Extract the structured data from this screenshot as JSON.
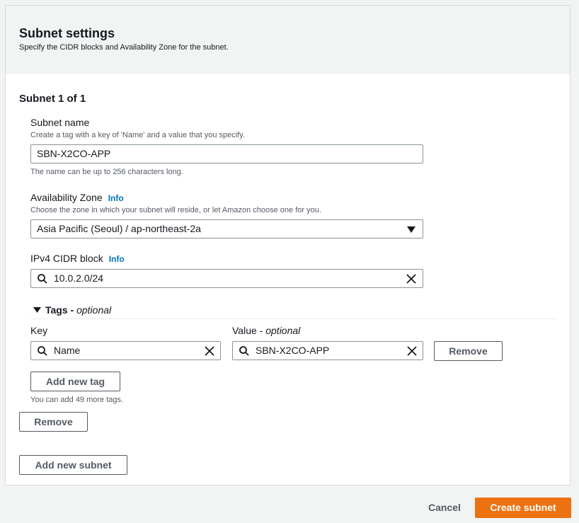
{
  "section": {
    "title": "Subnet settings",
    "description": "Specify the CIDR blocks and Availability Zone for the subnet."
  },
  "subnet": {
    "heading": "Subnet 1 of 1",
    "name": {
      "label": "Subnet name",
      "description": "Create a tag with a key of 'Name' and a value that you specify.",
      "value": "SBN-X2CO-APP",
      "hint": "The name can be up to 256 characters long."
    },
    "az": {
      "label": "Availability Zone",
      "info": "Info",
      "description": "Choose the zone in which your subnet will reside, or let Amazon choose one for you.",
      "value": "Asia Pacific (Seoul) / ap-northeast-2a"
    },
    "cidr": {
      "label": "IPv4 CIDR block",
      "info": "Info",
      "value": "10.0.2.0/24"
    },
    "tags": {
      "label": "Tags",
      "optional": "optional",
      "separator": " - ",
      "key_header": "Key",
      "value_header": "Value",
      "rows": [
        {
          "key": "Name",
          "value": "SBN-X2CO-APP",
          "remove_label": "Remove"
        }
      ],
      "add_label": "Add new tag",
      "limit_hint": "You can add 49 more tags."
    },
    "remove_label": "Remove"
  },
  "add_subnet_label": "Add new subnet",
  "footer": {
    "cancel_label": "Cancel",
    "create_label": "Create subnet"
  },
  "colors": {
    "primary": "#ec7211",
    "link": "#0073bb",
    "border": "#879596"
  }
}
